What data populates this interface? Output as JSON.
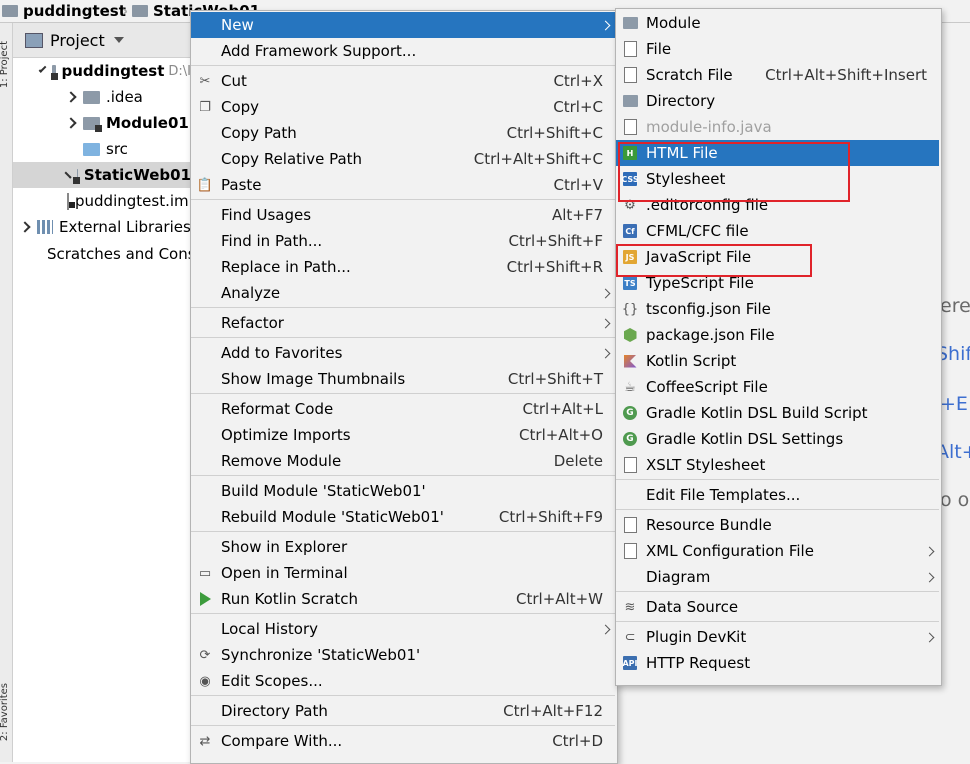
{
  "breadcrumb": [
    "puddingtest",
    "StaticWeb01"
  ],
  "left_stripe": {
    "project_tab": "1: Project",
    "favorites_tab": "2: Favorites"
  },
  "project_panel": {
    "title": "Project",
    "tree": [
      {
        "label": "puddingtest",
        "extra": "D:\\I",
        "bold": true,
        "arrow": "down",
        "icon": "module-folder-icon"
      },
      {
        "label": ".idea",
        "arrow": "right",
        "icon": "folder-icon"
      },
      {
        "label": "Module01",
        "bold": true,
        "arrow": "right",
        "icon": "module-folder-icon"
      },
      {
        "label": "src",
        "icon": "source-folder-icon"
      },
      {
        "label": "StaticWeb01",
        "bold": true,
        "arrow": "right",
        "icon": "module-folder-icon",
        "selected": true
      },
      {
        "label": "puddingtest.iml",
        "icon": "iml-file-icon"
      },
      {
        "label": "External Libraries",
        "arrow": "right",
        "icon": "library-icon"
      },
      {
        "label": "Scratches and Consoles",
        "icon": "scratches-icon"
      }
    ]
  },
  "editor_hints": [
    "ere",
    "Shif",
    "+E",
    "Alt+",
    "o o"
  ],
  "context_menu": {
    "items": [
      {
        "label": "New",
        "submenu": true,
        "highlighted": true
      },
      {
        "label": "Add Framework Support..."
      },
      {
        "sep": true
      },
      {
        "label": "Cut",
        "shortcut": "Ctrl+X",
        "icon": "cut-icon"
      },
      {
        "label": "Copy",
        "shortcut": "Ctrl+C",
        "icon": "copy-icon"
      },
      {
        "label": "Copy Path",
        "shortcut": "Ctrl+Shift+C"
      },
      {
        "label": "Copy Relative Path",
        "shortcut": "Ctrl+Alt+Shift+C"
      },
      {
        "label": "Paste",
        "shortcut": "Ctrl+V",
        "icon": "paste-icon"
      },
      {
        "sep": true
      },
      {
        "label": "Find Usages",
        "shortcut": "Alt+F7"
      },
      {
        "label": "Find in Path...",
        "shortcut": "Ctrl+Shift+F"
      },
      {
        "label": "Replace in Path...",
        "shortcut": "Ctrl+Shift+R"
      },
      {
        "label": "Analyze",
        "submenu": true
      },
      {
        "sep": true
      },
      {
        "label": "Refactor",
        "submenu": true
      },
      {
        "sep": true
      },
      {
        "label": "Add to Favorites",
        "submenu": true
      },
      {
        "label": "Show Image Thumbnails",
        "shortcut": "Ctrl+Shift+T"
      },
      {
        "sep": true
      },
      {
        "label": "Reformat Code",
        "shortcut": "Ctrl+Alt+L"
      },
      {
        "label": "Optimize Imports",
        "shortcut": "Ctrl+Alt+O"
      },
      {
        "label": "Remove Module",
        "shortcut": "Delete"
      },
      {
        "sep": true
      },
      {
        "label": "Build Module 'StaticWeb01'"
      },
      {
        "label": "Rebuild Module 'StaticWeb01'",
        "shortcut": "Ctrl+Shift+F9"
      },
      {
        "sep": true
      },
      {
        "label": "Show in Explorer"
      },
      {
        "label": "Open in Terminal",
        "icon": "terminal-icon"
      },
      {
        "label": "Run Kotlin Scratch",
        "shortcut": "Ctrl+Alt+W",
        "icon": "run-icon"
      },
      {
        "sep": true
      },
      {
        "label": "Local History",
        "submenu": true
      },
      {
        "label": "Synchronize 'StaticWeb01'",
        "icon": "sync-icon"
      },
      {
        "label": "Edit Scopes...",
        "icon": "scopes-icon"
      },
      {
        "sep": true
      },
      {
        "label": "Directory Path",
        "shortcut": "Ctrl+Alt+F12"
      },
      {
        "sep": true
      },
      {
        "label": "Compare With...",
        "shortcut": "Ctrl+D",
        "icon": "compare-icon"
      }
    ]
  },
  "new_submenu": {
    "items": [
      {
        "label": "Module",
        "icon": "module-icon"
      },
      {
        "label": "File",
        "icon": "file-icon"
      },
      {
        "label": "Scratch File",
        "shortcut": "Ctrl+Alt+Shift+Insert",
        "icon": "scratch-file-icon"
      },
      {
        "label": "Directory",
        "icon": "directory-icon"
      },
      {
        "label": "module-info.java",
        "icon": "java-file-icon",
        "disabled": true
      },
      {
        "label": "HTML File",
        "icon": "html-file-icon",
        "highlighted": true,
        "badge": "H",
        "badge_color": "#3a9a3a"
      },
      {
        "label": "Stylesheet",
        "icon": "css-file-icon",
        "badge": "CSS",
        "badge_color": "#2d6bb8"
      },
      {
        "label": ".editorconfig file",
        "icon": "editorconfig-icon"
      },
      {
        "label": "CFML/CFC file",
        "icon": "cfml-file-icon",
        "badge": "Cf",
        "badge_color": "#3b6fb5"
      },
      {
        "label": "JavaScript File",
        "icon": "js-file-icon",
        "badge": "JS",
        "badge_color": "#e2a633"
      },
      {
        "label": "TypeScript File",
        "icon": "ts-file-icon",
        "badge": "TS",
        "badge_color": "#3c7fc6"
      },
      {
        "label": "tsconfig.json File",
        "icon": "tsconfig-file-icon"
      },
      {
        "label": "package.json File",
        "icon": "nodejs-icon"
      },
      {
        "label": "Kotlin Script",
        "icon": "kotlin-icon"
      },
      {
        "label": "CoffeeScript File",
        "icon": "coffeescript-icon"
      },
      {
        "label": "Gradle Kotlin DSL Build Script",
        "icon": "gradle-icon",
        "badge": "G",
        "badge_color": "#4f9a4f"
      },
      {
        "label": "Gradle Kotlin DSL Settings",
        "icon": "gradle-icon",
        "badge": "G",
        "badge_color": "#4f9a4f"
      },
      {
        "label": "XSLT Stylesheet",
        "icon": "xslt-file-icon"
      },
      {
        "sep": true
      },
      {
        "label": "Edit File Templates..."
      },
      {
        "sep": true
      },
      {
        "label": "Resource Bundle",
        "icon": "resource-bundle-icon"
      },
      {
        "label": "XML Configuration File",
        "icon": "xml-file-icon",
        "submenu": true
      },
      {
        "label": "Diagram",
        "submenu": true
      },
      {
        "sep": true
      },
      {
        "label": "Data Source",
        "icon": "database-icon"
      },
      {
        "sep": true
      },
      {
        "label": "Plugin DevKit",
        "icon": "plugin-icon",
        "submenu": true
      },
      {
        "label": "HTTP Request",
        "icon": "api-icon",
        "badge": "API",
        "badge_color": "#3c6fb0"
      }
    ]
  },
  "colors": {
    "highlight": "#2675bf",
    "annotation_box": "#e0232a"
  }
}
